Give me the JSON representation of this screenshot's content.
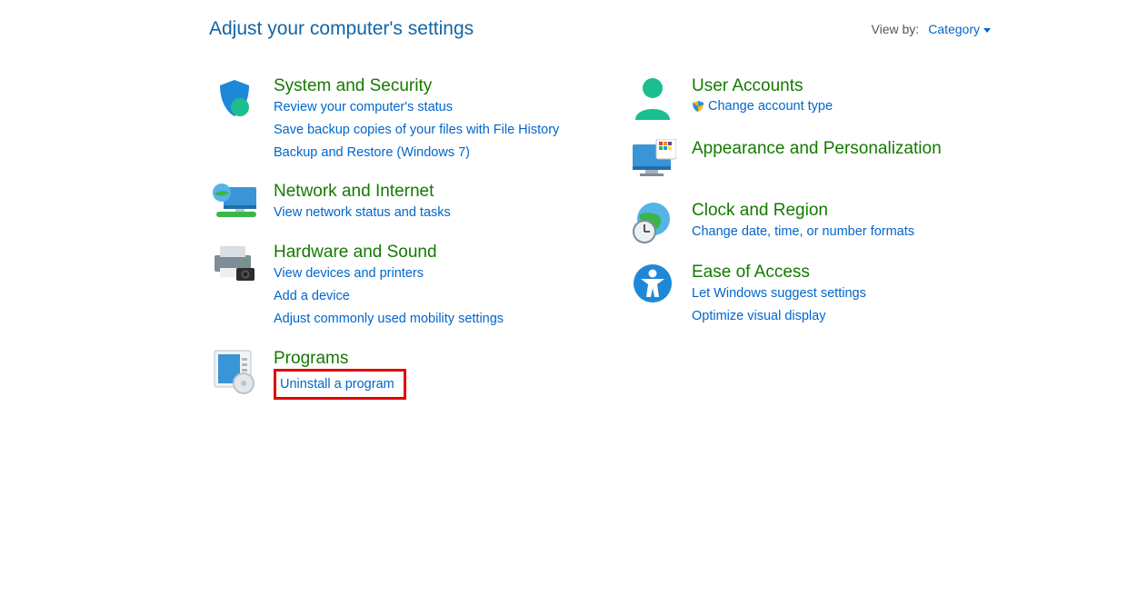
{
  "header": {
    "title": "Adjust your computer's settings",
    "viewby_label": "View by:",
    "viewby_value": "Category"
  },
  "left": {
    "system": {
      "title": "System and Security",
      "links": [
        "Review your computer's status",
        "Save backup copies of your files with File History",
        "Backup and Restore (Windows 7)"
      ]
    },
    "network": {
      "title": "Network and Internet",
      "links": [
        "View network status and tasks"
      ]
    },
    "hardware": {
      "title": "Hardware and Sound",
      "links": [
        "View devices and printers",
        "Add a device",
        "Adjust commonly used mobility settings"
      ]
    },
    "programs": {
      "title": "Programs",
      "links": [
        "Uninstall a program"
      ]
    }
  },
  "right": {
    "users": {
      "title": "User Accounts",
      "links": [
        "Change account type"
      ]
    },
    "appearance": {
      "title": "Appearance and Personalization"
    },
    "clock": {
      "title": "Clock and Region",
      "links": [
        "Change date, time, or number formats"
      ]
    },
    "ease": {
      "title": "Ease of Access",
      "links": [
        "Let Windows suggest settings",
        "Optimize visual display"
      ]
    }
  }
}
